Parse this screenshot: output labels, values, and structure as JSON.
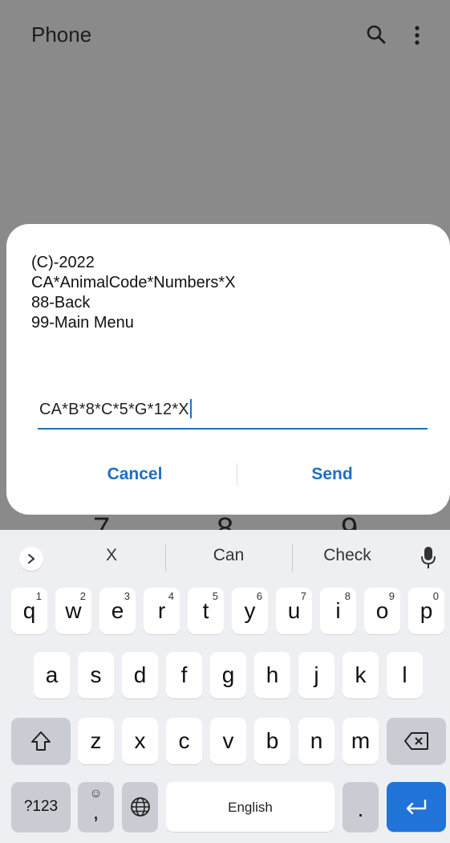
{
  "app_bar": {
    "title": "Phone",
    "search_icon": "search-icon",
    "more_icon": "more-vert-icon"
  },
  "dialer_peek": [
    "7",
    "8",
    "9"
  ],
  "dialog": {
    "message_lines": [
      "(C)-2022",
      "CA*AnimalCode*Numbers*X",
      "88-Back",
      "99-Main Menu"
    ],
    "input_value": "CA*B*8*C*5*G*12*X",
    "cancel_label": "Cancel",
    "send_label": "Send",
    "accent_color": "#1f6fc0"
  },
  "keyboard": {
    "suggestions": [
      "X",
      "Can",
      "Check"
    ],
    "row1": [
      {
        "key": "q",
        "hint": "1"
      },
      {
        "key": "w",
        "hint": "2"
      },
      {
        "key": "e",
        "hint": "3"
      },
      {
        "key": "r",
        "hint": "4"
      },
      {
        "key": "t",
        "hint": "5"
      },
      {
        "key": "y",
        "hint": "6"
      },
      {
        "key": "u",
        "hint": "7"
      },
      {
        "key": "i",
        "hint": "8"
      },
      {
        "key": "o",
        "hint": "9"
      },
      {
        "key": "p",
        "hint": "0"
      }
    ],
    "row2": [
      "a",
      "s",
      "d",
      "f",
      "g",
      "h",
      "j",
      "k",
      "l"
    ],
    "row3": [
      "z",
      "x",
      "c",
      "v",
      "b",
      "n",
      "m"
    ],
    "symbols_label": "?123",
    "emoji_comma_label": ",",
    "space_label": "English",
    "period_label": ".",
    "enter_color": "#1f73d9"
  }
}
